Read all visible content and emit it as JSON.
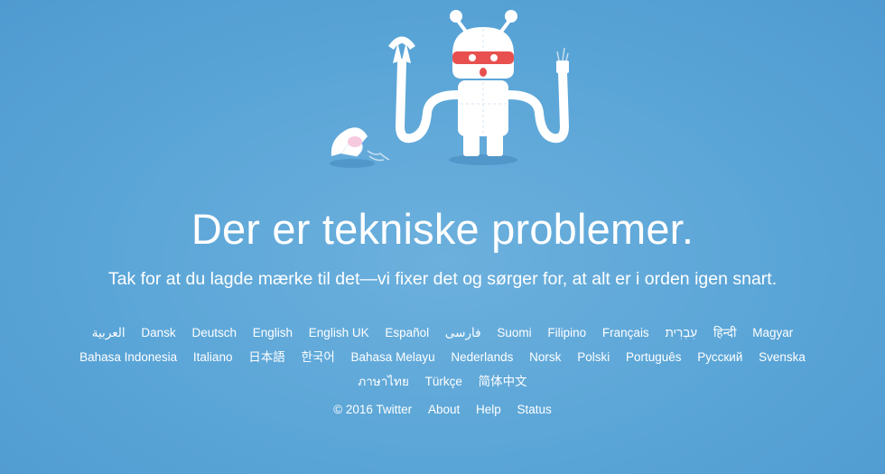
{
  "headline": "Der er tekniske problemer.",
  "subline": "Tak for at du lagde mærke til det—vi fixer det og sørger for, at alt er i orden igen snart.",
  "languages": {
    "row1": [
      "العربية",
      "Dansk",
      "Deutsch",
      "English",
      "English UK",
      "Español",
      "فارسی",
      "Suomi",
      "Filipino",
      "Français",
      "עִבְרִית",
      "हिन्दी",
      "Magyar"
    ],
    "row2": [
      "Bahasa Indonesia",
      "Italiano",
      "日本語",
      "한국어",
      "Bahasa Melayu",
      "Nederlands",
      "Norsk",
      "Polski",
      "Português",
      "Русский",
      "Svenska"
    ],
    "row3": [
      "ภาษาไทย",
      "Türkçe",
      "简体中文"
    ]
  },
  "footer": {
    "copyright": "© 2016 Twitter",
    "about": "About",
    "help": "Help",
    "status": "Status"
  },
  "colors": {
    "background": "#5aa5d7",
    "text": "#ffffff",
    "robot_visor": "#e8504f"
  },
  "illustration": "broken-robot-icon"
}
